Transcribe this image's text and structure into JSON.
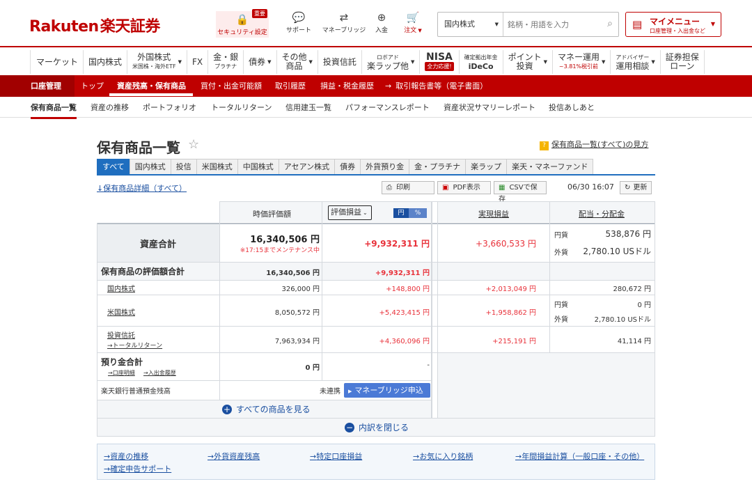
{
  "header": {
    "logo_en": "Rakuten",
    "logo_jp": "楽天証券",
    "security": {
      "label": "セキュリティ設定",
      "badge": "重要"
    },
    "support": "サポート",
    "moneybridge": "マネーブリッジ",
    "deposit": "入金",
    "order": "注文",
    "search": {
      "category": "国内株式",
      "placeholder": "銘柄・用語を入力"
    },
    "mymenu": {
      "title": "マイメニュー",
      "sub": "口座管理・入出金など"
    }
  },
  "gnav": [
    {
      "main": "マーケット",
      "sub": ""
    },
    {
      "main": "国内株式",
      "sub": ""
    },
    {
      "main": "外国株式",
      "sub": "米国株・海外ETF"
    },
    {
      "main": "FX",
      "sub": ""
    },
    {
      "main": "金・銀",
      "sub": "プラチナ"
    },
    {
      "main": "債券",
      "sub": ""
    },
    {
      "main": "その他",
      "sub": "商品"
    },
    {
      "main": "投資信託",
      "sub": ""
    },
    {
      "main": "ロボアド",
      "sub": "楽ラップ他"
    },
    {
      "main": "NISA",
      "sub": "全力応援!"
    },
    {
      "main": "確定拠出年金",
      "sub": "iDeCo"
    },
    {
      "main": "ポイント",
      "sub": "投資"
    },
    {
      "main": "マネー運用",
      "sub": "~3.81%税引前"
    },
    {
      "main": "アドバイザー",
      "sub": "運用相談"
    },
    {
      "main": "証券担保",
      "sub": "ローン"
    }
  ],
  "redband": {
    "section": "口座管理",
    "items": [
      "トップ",
      "資産残高・保有商品",
      "買付・出金可能額",
      "取引履歴",
      "損益・税金履歴",
      "取引報告書等（電子書面）"
    ]
  },
  "subnav": [
    "保有商品一覧",
    "資産の推移",
    "ポートフォリオ",
    "トータルリターン",
    "信用建玉一覧",
    "パフォーマンスレポート",
    "資産状況サマリーレポート",
    "投信あしあと"
  ],
  "page": {
    "title": "保有商品一覧",
    "help": "保有商品一覧(すべて)の見方",
    "tabs": [
      "すべて",
      "国内株式",
      "投信",
      "米国株式",
      "中国株式",
      "アセアン株式",
      "債券",
      "外貨預り金",
      "金・プラチナ",
      "楽ラップ",
      "楽天・マネーファンド"
    ],
    "detail_link": "↓保有商品詳細（すべて）",
    "print": "印刷",
    "pdf": "PDF表示",
    "csv": "CSVで保存",
    "timestamp": "06/30 16:07",
    "refresh": "更新"
  },
  "table": {
    "h_market": "時価評価額",
    "h_select": "評価損益",
    "h_yen": "円",
    "h_pct": "%",
    "h_realized": "実現損益",
    "h_dividend": "配当・分配金",
    "total": {
      "label": "資産合計",
      "market": "16,340,506 円",
      "note": "※17:15までメンテナンス中",
      "unreal": "+9,932,311 円",
      "realized": "+3,660,533 円",
      "div_yen_label": "円貨",
      "div_yen": "538,876 円",
      "div_fx_label": "外貨",
      "div_fx": "2,780.10 USドル"
    },
    "holdings": {
      "label": "保有商品の評価額合計",
      "market": "16,340,506 円",
      "unreal": "+9,932,311 円"
    },
    "rows": [
      {
        "label": "国内株式",
        "market": "326,000 円",
        "unreal": "+148,800 円",
        "realized": "+2,013,049 円",
        "dividend": "280,672 円"
      },
      {
        "label": "米国株式",
        "market": "8,050,572 円",
        "unreal": "+5,423,415 円",
        "realized": "+1,958,862 円",
        "div_yen_label": "円貨",
        "div_yen": "0 円",
        "div_fx_label": "外貨",
        "div_fx": "2,780.10 USドル"
      },
      {
        "label": "投資信託",
        "sublink": "→トータルリターン",
        "market": "7,963,934 円",
        "unreal": "+4,360,096 円",
        "realized": "+215,191 円",
        "dividend": "41,114 円"
      }
    ],
    "deposit": {
      "label": "預り金合計",
      "link1": "→口座明細",
      "link2": "→入出金履歴",
      "market": "0 円",
      "unreal": "-"
    },
    "bank": {
      "label": "楽天銀行普通預金残高",
      "status": "未連携",
      "button": "マネーブリッジ申込"
    },
    "show_all": "すべての商品を見る",
    "close": "内訳を閉じる"
  },
  "bottom_links": [
    "資産の推移",
    "外貨資産残高",
    "特定口座損益",
    "お気に入り銘柄",
    "年間損益計算（一般口座・その他）",
    "確定申告サポート"
  ]
}
